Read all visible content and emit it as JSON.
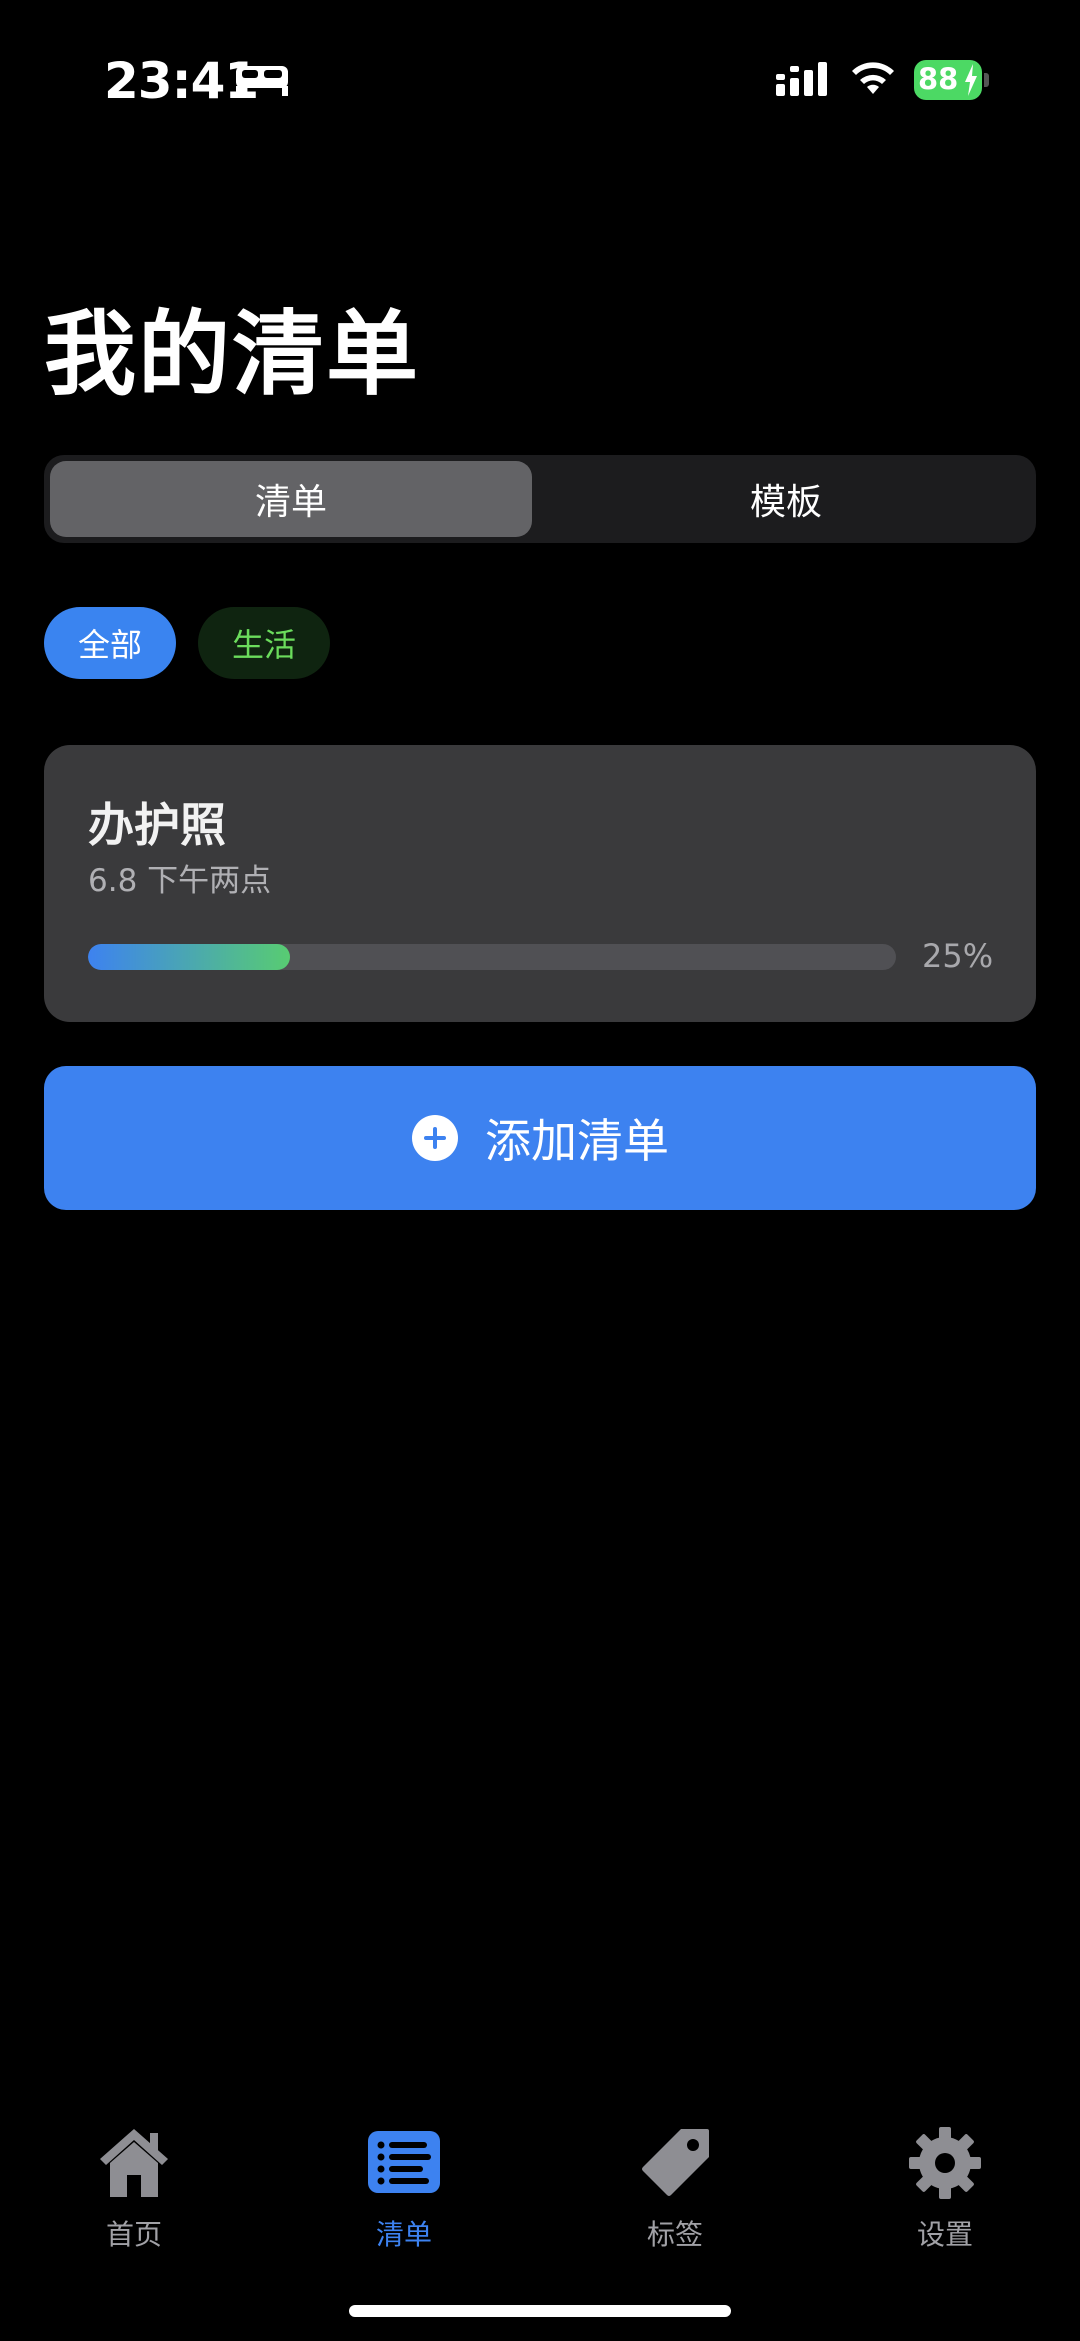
{
  "status_bar": {
    "time": "23:41",
    "battery": "88"
  },
  "page": {
    "title": "我的清单"
  },
  "segmented": {
    "left": "清单",
    "right": "模板"
  },
  "filters": {
    "all": "全部",
    "life": "生活"
  },
  "card": {
    "title": "办护照",
    "subtitle": "6.8 下午两点",
    "progress_label": "25%",
    "progress": 0.25
  },
  "add_button": {
    "label": "添加清单"
  },
  "tab_bar": {
    "home": "首页",
    "list": "清单",
    "tags": "标签",
    "settings": "设置"
  },
  "colors": {
    "accent": "#3d82f0",
    "green": "#58cc72",
    "card": "#3a3a3c"
  },
  "icons": [
    "bed-icon",
    "signal-icon",
    "wifi-icon",
    "battery-icon",
    "plus-circle-icon",
    "house-icon",
    "list-icon",
    "tag-icon",
    "gear-icon"
  ]
}
